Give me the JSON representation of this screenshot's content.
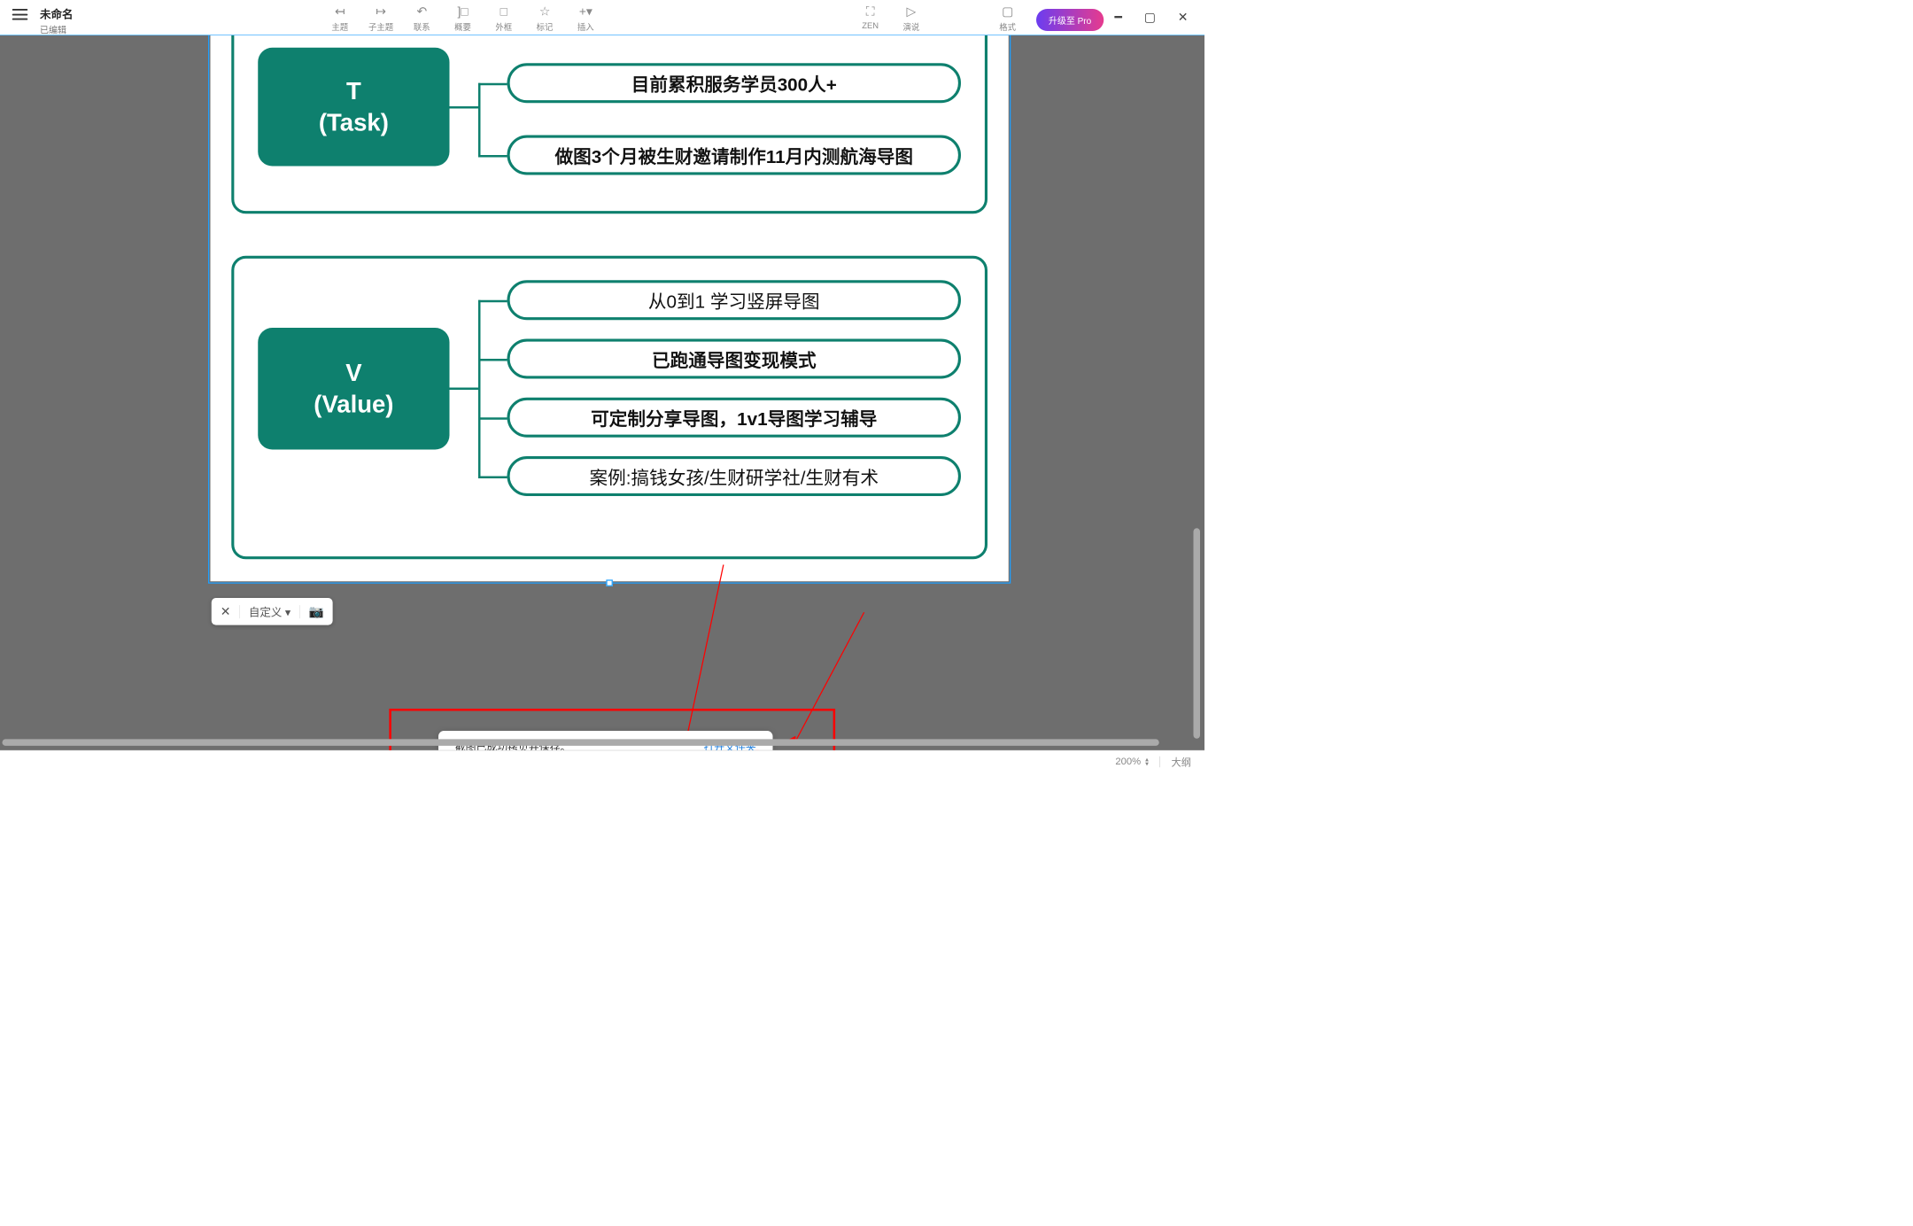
{
  "colors": {
    "teal": "#0e806e",
    "selection_blue": "#1e9fff",
    "red_annotation": "#ff0000",
    "toast_link": "#1e7fe0",
    "upgrade_gradient_start": "#6b3df0",
    "upgrade_gradient_end": "#e63b8e"
  },
  "titlebar": {
    "filename": "未命名",
    "status": "已编辑"
  },
  "toolbar": [
    {
      "icon": "↤",
      "label": "主题",
      "name": "topic"
    },
    {
      "icon": "↦",
      "label": "子主题",
      "name": "subtopic"
    },
    {
      "icon": "↶",
      "label": "联系",
      "name": "relation"
    },
    {
      "icon": "]□",
      "label": "概要",
      "name": "summary"
    },
    {
      "icon": "□",
      "label": "外框",
      "name": "boundary"
    },
    {
      "icon": "☆",
      "label": "标记",
      "name": "marker"
    },
    {
      "icon": "+▾",
      "label": "插入",
      "name": "insert"
    }
  ],
  "toolbar_right": [
    {
      "icon": "⛶",
      "label": "ZEN",
      "name": "zen"
    },
    {
      "icon": "▷",
      "label": "演说",
      "name": "present"
    },
    {
      "icon": "▢",
      "label": "格式",
      "name": "format"
    }
  ],
  "upgrade_label": "升级至 Pro",
  "mindmap": {
    "task": {
      "topic_line1": "T",
      "topic_line2": "(Task)",
      "children": [
        "目前累积服务学员300人+",
        "做图3个月被生财邀请制作11月内测航海导图"
      ]
    },
    "value": {
      "topic_line1": "V",
      "topic_line2": "(Value)",
      "children": [
        "从0到1 学习竖屏导图",
        "已跑通导图变现模式",
        "可定制分享导图，1v1导图学习辅导",
        "案例:搞钱女孩/生财研学社/生财有术"
      ]
    }
  },
  "float_toolbar": {
    "custom_label": "自定义",
    "dropdown_indicator": "▾"
  },
  "toast": {
    "message": "截图已成功拷贝并保存。",
    "link": "打开文件夹"
  },
  "statusbar": {
    "zoom": "200%",
    "outline": "大纲"
  }
}
